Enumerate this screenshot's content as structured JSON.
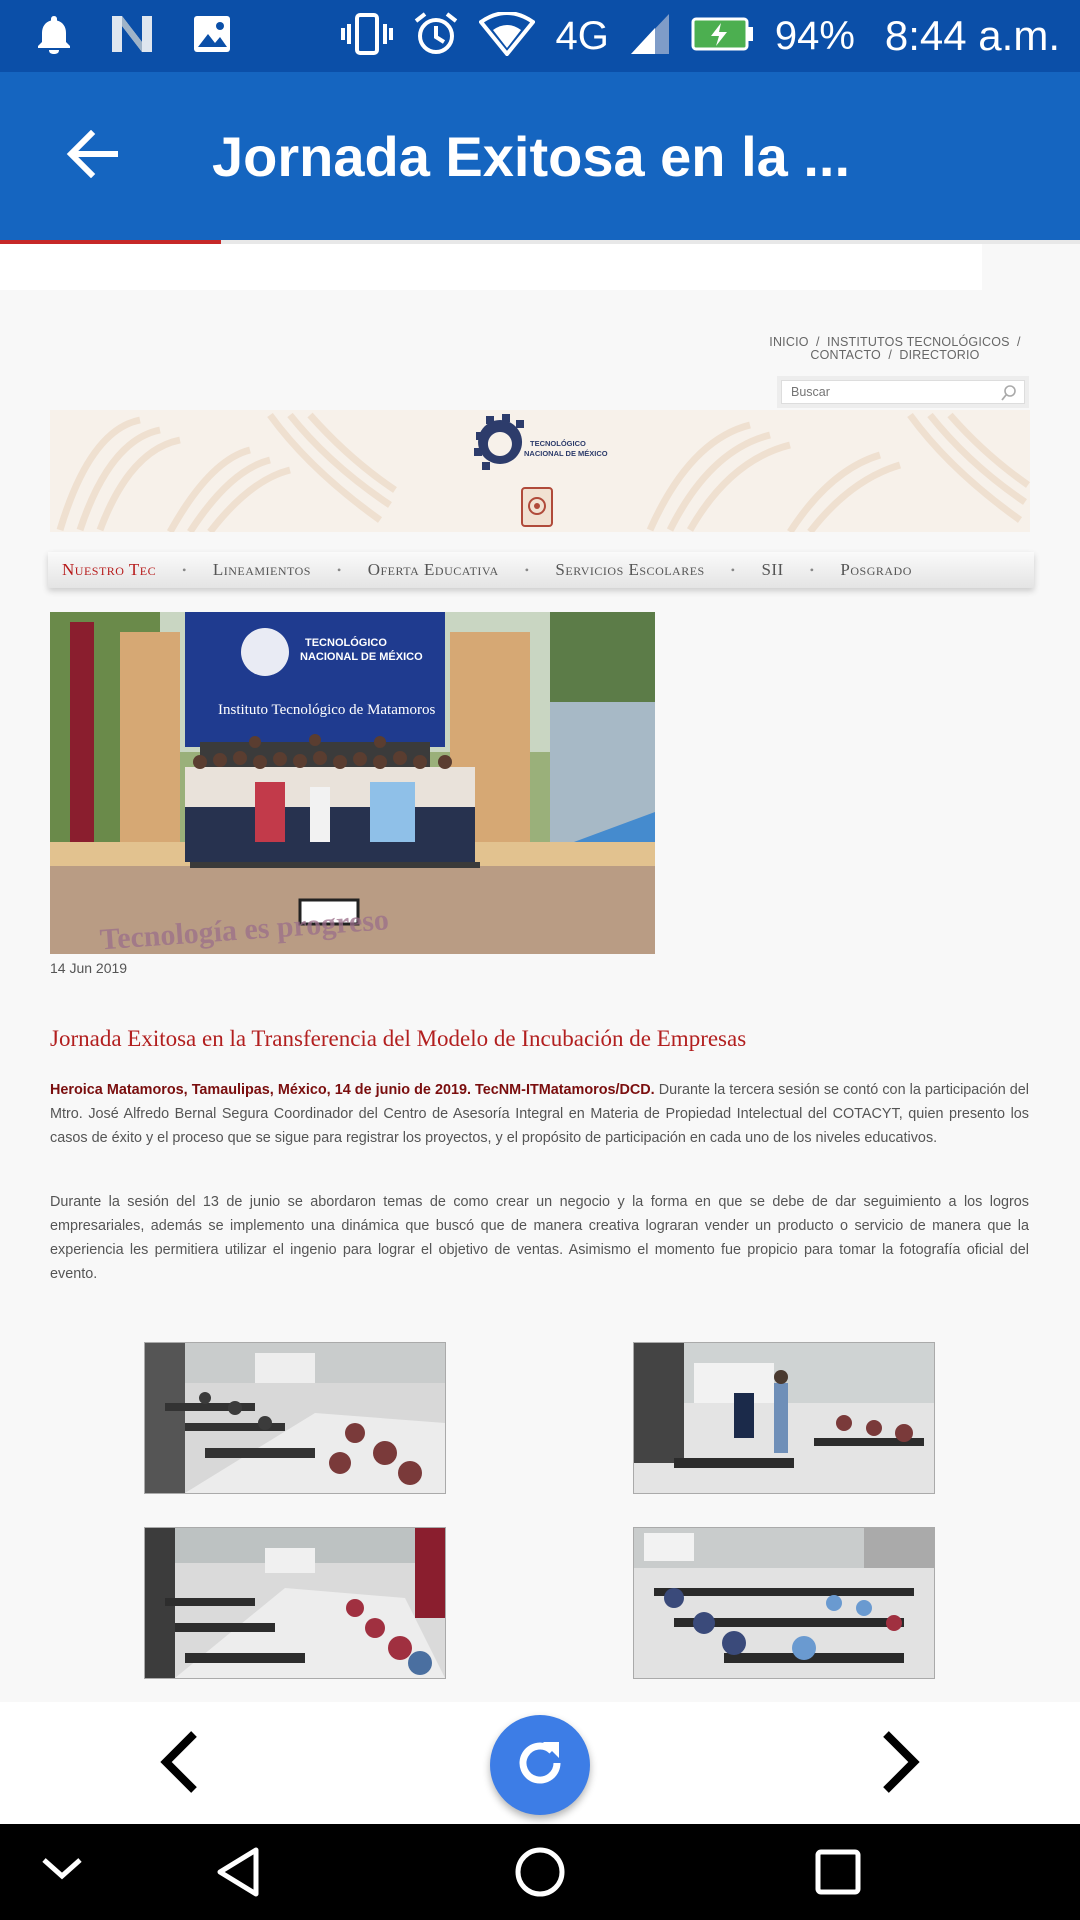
{
  "status_bar": {
    "network": "4G",
    "battery": "94%",
    "time": "8:44 a.m."
  },
  "app_bar": {
    "title": "Jornada Exitosa en la ..."
  },
  "page_load_progress": 0.205,
  "site": {
    "top_links": [
      "INICIO",
      "INSTITUTOS TECNOLÓGICOS",
      "CONTACTO",
      "DIRECTORIO"
    ],
    "search_placeholder": "Buscar",
    "logo_text_line1": "TECNOLÓGICO",
    "logo_text_line2": "NACIONAL DE MÉXICO",
    "main_nav": [
      "Nuestro Tec",
      "Lineamientos",
      "Oferta Educativa",
      "Servicios Escolares",
      "SII",
      "Posgrado"
    ],
    "active_nav_index": 0
  },
  "article": {
    "hero_sign_line1": "TECNOLÓGICO",
    "hero_sign_line2": "NACIONAL DE MÉXICO",
    "hero_sign_line3": "Instituto Tecnológico de Matamoros",
    "hero_ground_text": "Tecnología es progreso",
    "date": "14 Jun 2019",
    "title": "Jornada Exitosa en la Transferencia del Modelo de Incubación de Empresas",
    "lead_bold": "Heroica Matamoros, Tamaulipas, México, 14 de junio de 2019. TecNM-ITMatamoros/DCD.",
    "lead_rest": " Durante la tercera sesión se contó con la participación del Mtro. José Alfredo Bernal Segura Coordinador del Centro de Asesoría Integral en Materia de Propiedad Intelectual del COTACYT, quien presento los casos de éxito y el proceso que se sigue para registrar los proyectos,  y el propósito de participación en cada uno de  los niveles educativos.",
    "paragraph2": "Durante la sesión del 13 de junio se abordaron temas de como crear un negocio y la forma en que se debe de dar seguimiento a los logros empresariales, además se implemento una dinámica que buscó que de manera creativa lograran vender un producto o servicio de manera que la experiencia les permitiera utilizar el ingenio para lograr el objetivo de ventas. Asimismo el momento fue propicio para tomar la fotografía oficial del evento."
  },
  "colors": {
    "status_bar": "#0b4fa8",
    "app_bar": "#1565c0",
    "accent_red": "#b21f1f",
    "fab": "#3d7de6"
  },
  "icons": {
    "status_left": [
      "bell-icon",
      "n-icon",
      "image-icon"
    ],
    "status_right": [
      "vibrate-icon",
      "alarm-icon",
      "wifi-icon",
      "signal-icon",
      "battery-icon"
    ],
    "bottom": [
      "chevron-left-icon",
      "refresh-icon",
      "chevron-right-icon"
    ],
    "system": [
      "collapse-icon",
      "back-triangle-icon",
      "home-circle-icon",
      "recents-square-icon"
    ]
  }
}
